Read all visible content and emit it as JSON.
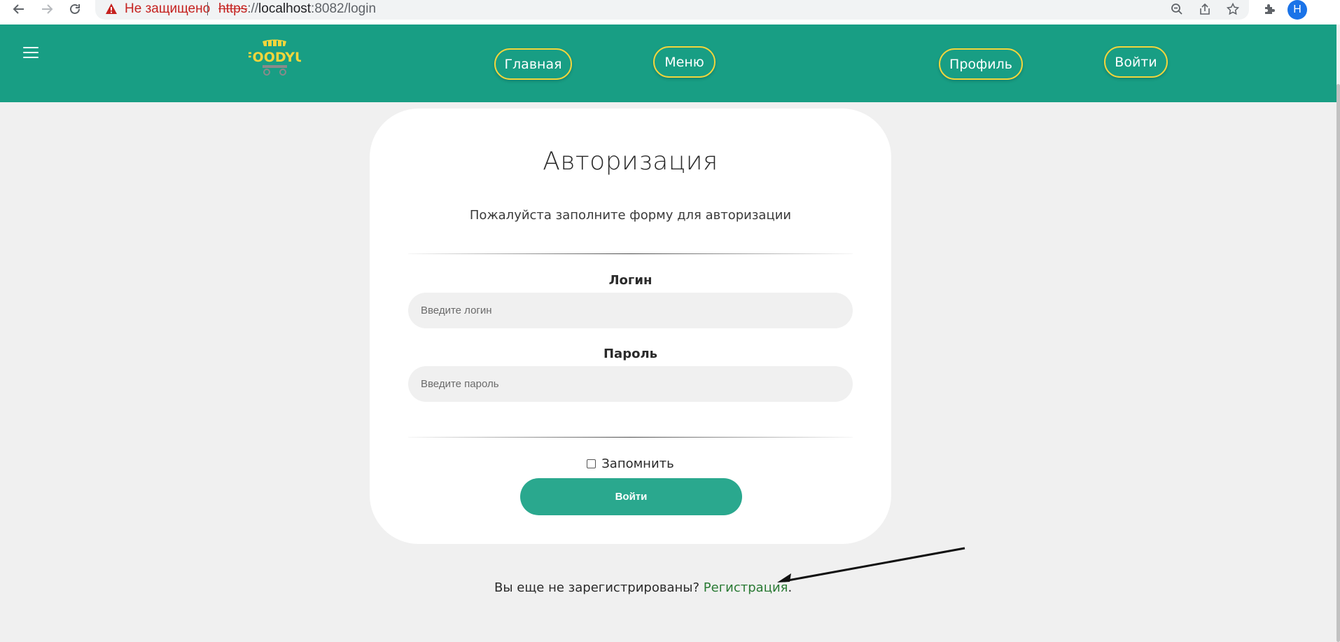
{
  "browser": {
    "security_status": "Не защищено",
    "url_scheme": "https",
    "url_rest_prefix": "://",
    "url_host": "localhost",
    "url_path": ":8082/login",
    "profile_initial": "Н"
  },
  "header": {
    "nav": [
      {
        "label": "Главная"
      },
      {
        "label": "Меню"
      },
      {
        "label": "Профиль"
      },
      {
        "label": "Войти"
      }
    ]
  },
  "login_form": {
    "title": "Авторизация",
    "subtitle": "Пожалуйста заполните форму для авторизации",
    "login_label": "Логин",
    "login_placeholder": "Введите логин",
    "password_label": "Пароль",
    "password_placeholder": "Введите пароль",
    "remember_label": "Запомнить",
    "submit_label": "Войти"
  },
  "register": {
    "prompt": "Вы еще не зарегистрированы?",
    "link_label": "Регистрация",
    "period": "."
  },
  "colors": {
    "header_bg": "#189e84",
    "nav_border": "#f2d53c",
    "button_bg": "#2aa88e",
    "link": "#2a7a34",
    "page_bg": "#f0f0f0"
  }
}
